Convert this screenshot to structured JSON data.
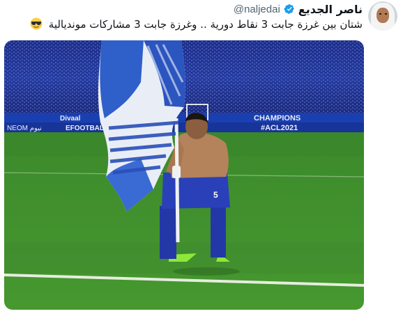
{
  "tweet": {
    "author_name": "ناصر الجديع",
    "handle": "@naljedai",
    "text": "شتان بين غرزة جابت 3 نقاط دورية .. وغرزة جابت 3 مشاركات مونديالية",
    "emoji": "sunglasses-face",
    "verified": true
  },
  "media": {
    "ad_boards": {
      "left_1": "Divaal",
      "left_2": "NEOM نيوم",
      "left_3": "EFOOTBALL",
      "right_1": "CHAMPIONS",
      "right_2": "#ACL2021"
    },
    "shirt_number": "5",
    "colors": {
      "pitch": "#3e8b2d",
      "kit_blue": "#2338a6",
      "flag_blue": "#2f5fc9",
      "boots": "#8ee83a"
    }
  }
}
